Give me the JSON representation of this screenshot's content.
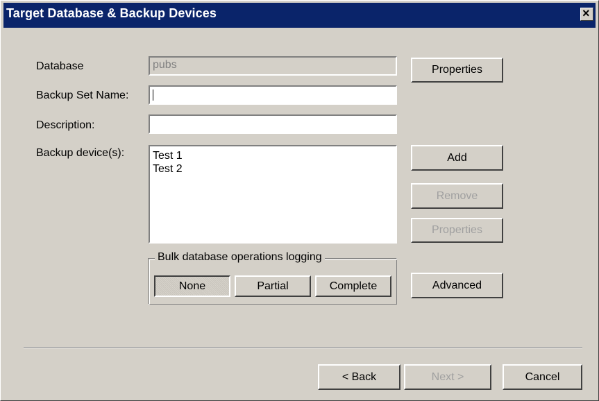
{
  "dialog": {
    "title": "Target Database & Backup Devices",
    "close_symbol": "×"
  },
  "form": {
    "database_label": "Database",
    "database_value": "pubs",
    "backup_set_name_label": "Backup Set Name:",
    "backup_set_name_value": "",
    "description_label": "Description:",
    "description_value": "",
    "backup_devices_label": "Backup device(s):",
    "devices": [
      "Test 1",
      "Test 2"
    ]
  },
  "buttons": {
    "properties_top": "Properties",
    "add": "Add",
    "remove": "Remove",
    "properties_bottom": "Properties",
    "advanced": "Advanced",
    "back": "< Back",
    "next": "Next >",
    "cancel": "Cancel"
  },
  "logging_group": {
    "title": "Bulk database operations logging",
    "options": [
      "None",
      "Partial",
      "Complete"
    ],
    "selected": "None"
  },
  "icons": {
    "close": "close-icon"
  },
  "colors": {
    "title_bar": "#0a246a",
    "dialog_bg": "#d4d0c8",
    "disabled_text": "#a0a0a0"
  }
}
